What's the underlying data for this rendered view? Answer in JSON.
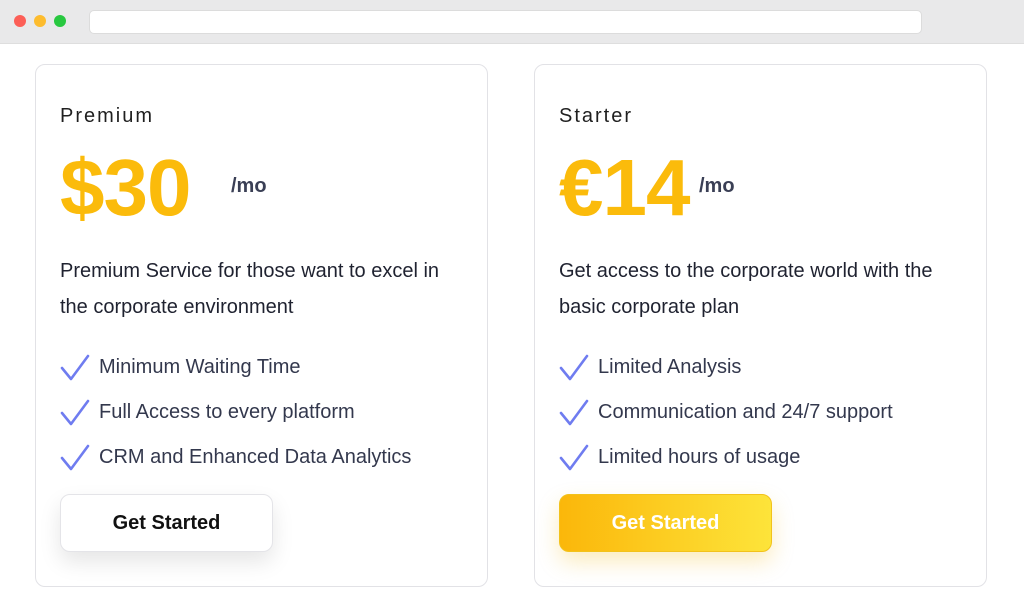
{
  "browser": {
    "controls": [
      "close",
      "minimize",
      "maximize"
    ],
    "address_value": ""
  },
  "colors": {
    "price": "#fbbb0b",
    "check": "#6f7cf0",
    "button_gradient_start": "#fbb70a",
    "button_gradient_end": "#fde43a"
  },
  "plans": [
    {
      "name": "Premium",
      "price": "$30",
      "period": "/mo",
      "description": "Premium Service for those want to excel in the corporate environment",
      "features": [
        "Minimum Waiting Time",
        "Full Access to every platform",
        "CRM and Enhanced Data Analytics"
      ],
      "button_label": "Get Started",
      "button_style": "white"
    },
    {
      "name": "Starter",
      "price": "€14",
      "period": "/mo",
      "description": "Get access to the corporate world with the basic corporate plan",
      "features": [
        "Limited Analysis",
        "Communication and 24/7 support",
        "Limited hours of usage"
      ],
      "button_label": "Get Started",
      "button_style": "yellow"
    }
  ]
}
